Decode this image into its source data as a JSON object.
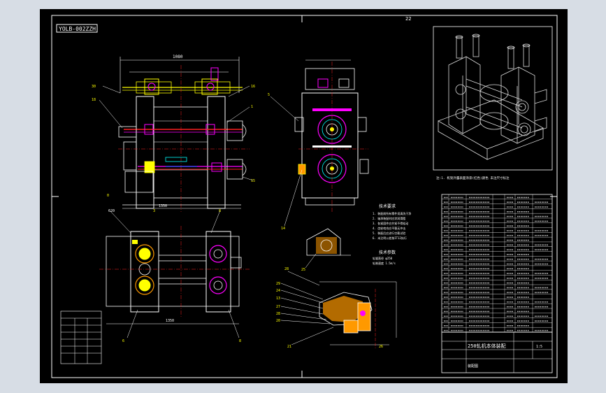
{
  "drawing": {
    "frame_code": "YOLB-002ZZH",
    "corner_mark": "22",
    "note_text": "注:1. 机架外露表面涂漆(红色)颜色 未注尺寸标注",
    "tech_req_title": "技术要求",
    "tech_req_lines": [
      "1. 装配前所有零件须清洗干净",
      "2. 轴承装配时应涂润滑脂",
      "3. 各紧固件应拧紧不得松动",
      "4. 齿轮啮合应平稳无冲击",
      "5. 装配后应进行空载试验",
      "6. 未注明公差按IT12执行"
    ],
    "section_title": "技术参数",
    "section_lines": [
      "轧辊直径 φ250",
      "轧制速度 1.5m/s"
    ],
    "title_block_name": "250轧机本体装配",
    "title_block_scale": "1:5",
    "title_block_drawn": "装配图",
    "dim_top_width": "1080",
    "dim_side_height": "620",
    "dim_bottom_width": "1350"
  },
  "colors": {
    "paper": "#000000",
    "frame": "#ffffff",
    "border_outer": "#d7dde5",
    "line_main": "#ffffff",
    "yellow": "#ffff00",
    "magenta": "#ff00ff",
    "red": "#ff2020",
    "cyan": "#00ffff",
    "green": "#00ff00",
    "blue": "#3050ff",
    "orange": "#ff9900"
  }
}
